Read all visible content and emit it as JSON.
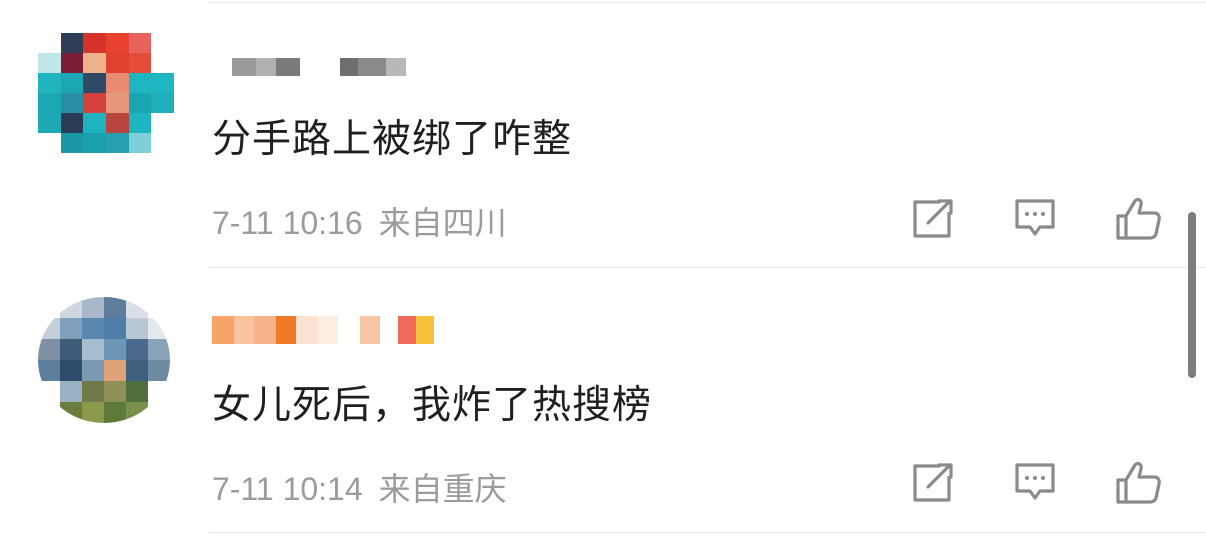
{
  "comments": [
    {
      "text": "分手路上被绑了咋整",
      "date": "7-11 10:16",
      "location": "来自四川"
    },
    {
      "text": "女儿死后，我炸了热搜榜",
      "date": "7-11 10:14",
      "location": "来自重庆"
    }
  ],
  "colors": {
    "text": "#1f1f1f",
    "meta": "#9b9b9b",
    "icon": "#8a8a8a",
    "separator": "#e6e6e6"
  },
  "icons": [
    "share-icon",
    "comment-icon",
    "like-icon"
  ]
}
